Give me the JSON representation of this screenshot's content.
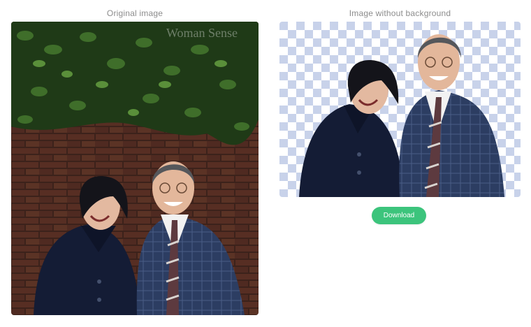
{
  "left_panel": {
    "label": "Original image",
    "watermark": "Woman Sense"
  },
  "right_panel": {
    "label": "Image without background"
  },
  "actions": {
    "download_label": "Download"
  },
  "colors": {
    "accent": "#3cc47c",
    "label": "#8c8c8c",
    "checker": "#c8d2ea"
  }
}
